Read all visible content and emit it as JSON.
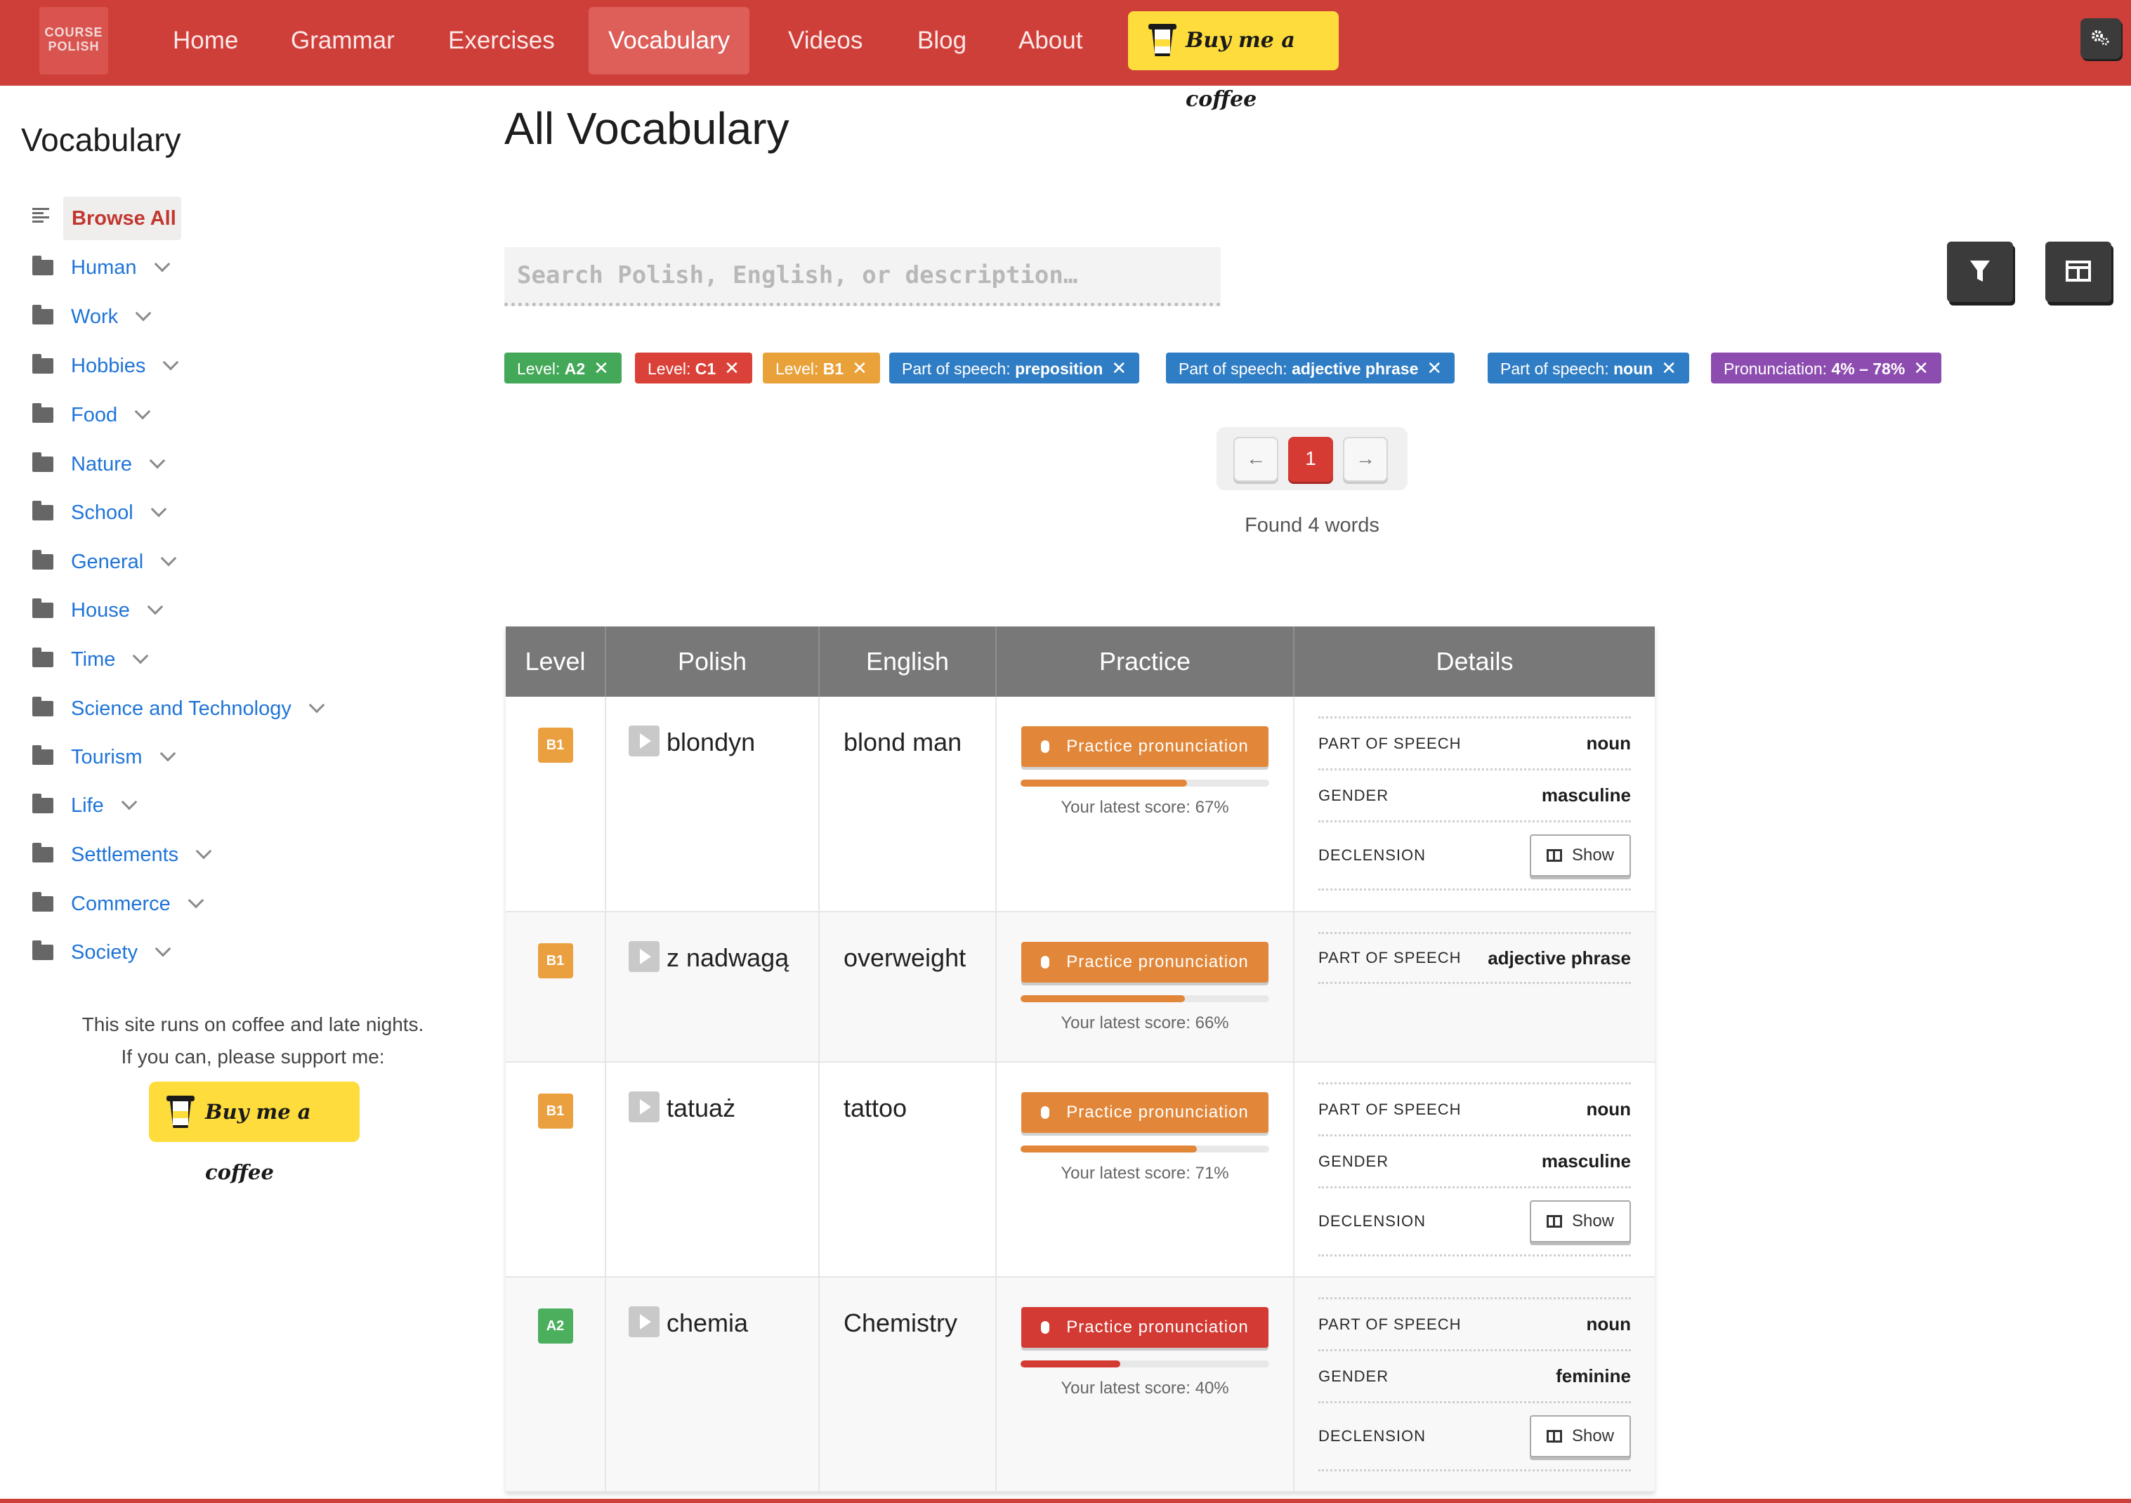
{
  "nav": {
    "logo_line1": "COURSE",
    "logo_line2": "POLISH",
    "items": [
      "Home",
      "Grammar",
      "Exercises",
      "Vocabulary",
      "Videos",
      "Blog",
      "About"
    ],
    "active": "Vocabulary",
    "coffee_label": "Buy me a coffee"
  },
  "sidebar": {
    "title": "Vocabulary",
    "browse_all": "Browse All",
    "categories": [
      "Human",
      "Work",
      "Hobbies",
      "Food",
      "Nature",
      "School",
      "General",
      "House",
      "Time",
      "Science and Technology",
      "Tourism",
      "Life",
      "Settlements",
      "Commerce",
      "Society"
    ],
    "note_line1": "This site runs on coffee and late nights.",
    "note_line2": "If you can, please support me:",
    "coffee_label": "Buy me a coffee"
  },
  "main": {
    "title": "All Vocabulary",
    "search_placeholder": "Search Polish, English, or description…",
    "chips": [
      {
        "label": "Level: ",
        "value": "A2",
        "color": "green"
      },
      {
        "label": "Level: ",
        "value": "C1",
        "color": "red"
      },
      {
        "label": "Level: ",
        "value": "B1",
        "color": "orange"
      },
      {
        "label": "Part of speech: ",
        "value": "preposition",
        "color": "blue"
      },
      {
        "label": "Part of speech: ",
        "value": "adjective phrase",
        "color": "blue"
      },
      {
        "label": "Part of speech: ",
        "value": "noun",
        "color": "blue"
      },
      {
        "label": "Pronunciation: ",
        "value": "4% – 78%",
        "color": "purple"
      }
    ],
    "pagination": {
      "prev": "←",
      "current": "1",
      "next": "→"
    },
    "found_text": "Found 4 words"
  },
  "table": {
    "headers": [
      "Level",
      "Polish",
      "English",
      "Practice",
      "Details"
    ],
    "practice_label": "Practice pronunciation",
    "show_label": "Show",
    "rows": [
      {
        "level": "B1",
        "polish": "blondyn",
        "english": "blond man",
        "score_pct": 67,
        "score_text": "Your latest score: 67%",
        "details": [
          {
            "key": "PART OF SPEECH",
            "value": "noun"
          },
          {
            "key": "GENDER",
            "value": "masculine"
          },
          {
            "key": "DECLENSION",
            "value": ""
          }
        ]
      },
      {
        "level": "B1",
        "polish": "z nadwagą",
        "english": "overweight",
        "score_pct": 66,
        "score_text": "Your latest score: 66%",
        "details": [
          {
            "key": "PART OF SPEECH",
            "value": "adjective phrase"
          }
        ]
      },
      {
        "level": "B1",
        "polish": "tatuaż",
        "english": "tattoo",
        "score_pct": 71,
        "score_text": "Your latest score: 71%",
        "details": [
          {
            "key": "PART OF SPEECH",
            "value": "noun"
          },
          {
            "key": "GENDER",
            "value": "masculine"
          },
          {
            "key": "DECLENSION",
            "value": ""
          }
        ]
      },
      {
        "level": "A2",
        "polish": "chemia",
        "english": "Chemistry",
        "score_pct": 40,
        "score_text": "Your latest score: 40%",
        "details": [
          {
            "key": "PART OF SPEECH",
            "value": "noun"
          },
          {
            "key": "GENDER",
            "value": "feminine"
          },
          {
            "key": "DECLENSION",
            "value": ""
          }
        ]
      }
    ]
  },
  "colors": {
    "brand_red": "#cf3f3a",
    "link_blue": "#1f74d8",
    "score_orange": "#e2873a",
    "score_red": "#d33a33"
  }
}
